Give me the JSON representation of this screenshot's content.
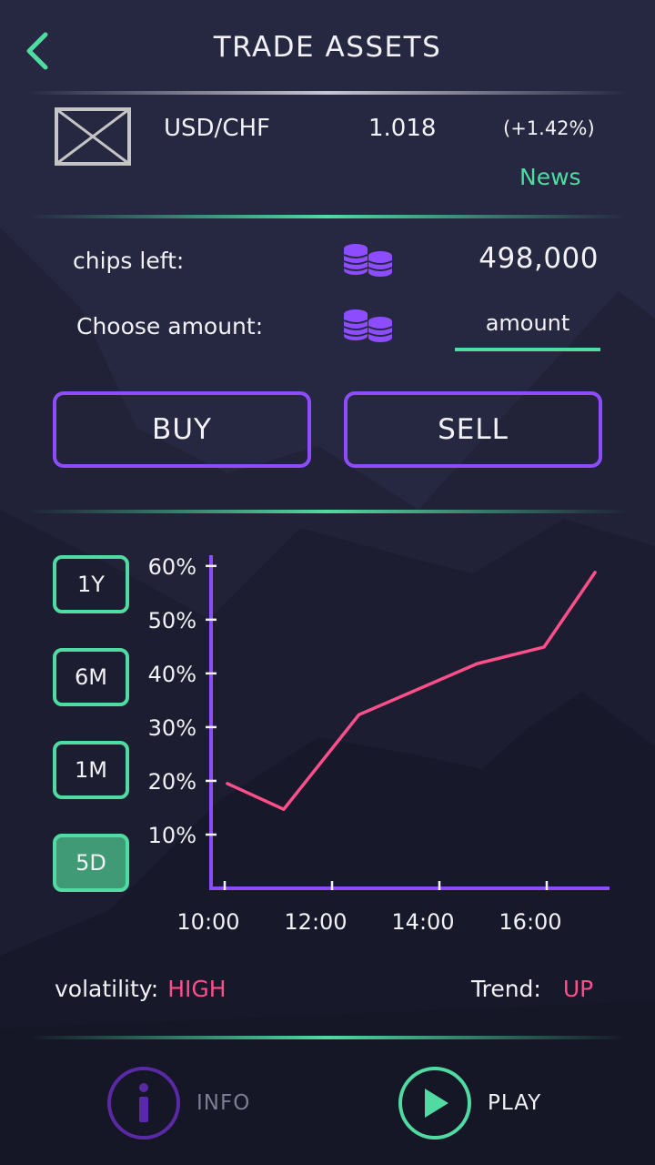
{
  "header": {
    "title": "TRADE ASSETS"
  },
  "asset": {
    "pair": "USD/CHF",
    "price": "1.018",
    "change": "(+1.42%)",
    "news_label": "News"
  },
  "trade": {
    "chips_label": "chips left:",
    "chips_value": "498,000",
    "amount_label": "Choose amount:",
    "amount_placeholder": "amount",
    "buy_label": "BUY",
    "sell_label": "SELL"
  },
  "ranges": [
    {
      "label": "1Y",
      "active": false
    },
    {
      "label": "6M",
      "active": false
    },
    {
      "label": "1M",
      "active": false
    },
    {
      "label": "5D",
      "active": true
    }
  ],
  "chart_data": {
    "type": "line",
    "title": "",
    "xlabel": "",
    "ylabel": "",
    "x_ticks": [
      "10:00",
      "12:00",
      "14:00",
      "16:00"
    ],
    "y_ticks": [
      "10%",
      "20%",
      "30%",
      "40%",
      "50%",
      "60%"
    ],
    "xlim": [
      10.0,
      17.1
    ],
    "ylim": [
      0,
      62
    ],
    "grid": false,
    "series": [
      {
        "color": "#ff4f8b",
        "x": [
          10.05,
          11.1,
          12.5,
          14.7,
          15.95,
          16.9
        ],
        "y": [
          19.5,
          14.7,
          32.3,
          41.8,
          44.9,
          58.8
        ]
      }
    ]
  },
  "stats": {
    "volatility_label": "volatility:",
    "volatility_value": "HIGH",
    "trend_label": "Trend:",
    "trend_value": "UP"
  },
  "nav": {
    "info_label": "INFO",
    "play_label": "PLAY"
  },
  "colors": {
    "accent_green": "#4fdba1",
    "accent_purple": "#8d4dff",
    "line_pink": "#ff4f8b",
    "background": "#262741"
  },
  "icons": {
    "back": "chevron-left-icon",
    "thumb": "image-placeholder-icon",
    "chips": "coins-icon",
    "info": "info-icon",
    "play": "play-icon"
  }
}
